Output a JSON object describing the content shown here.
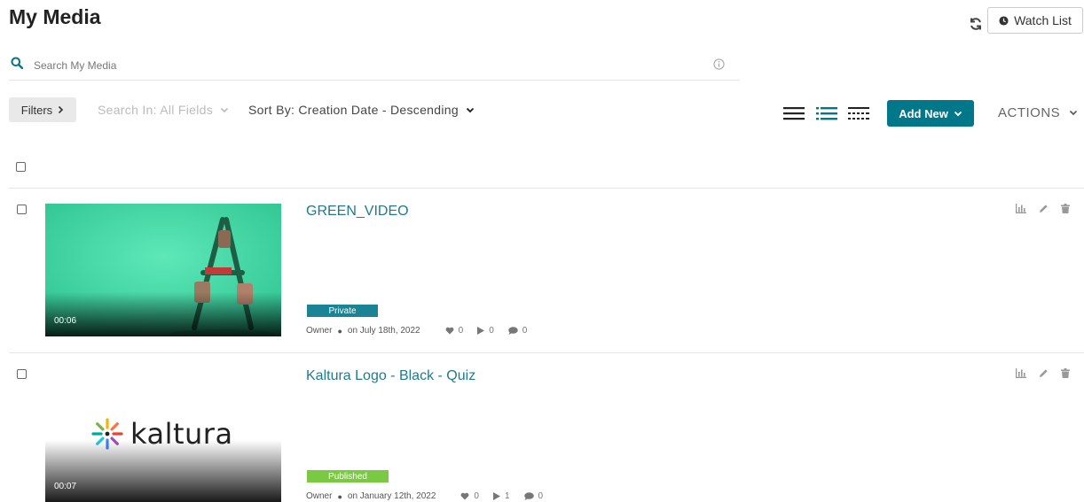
{
  "page": {
    "title": "My Media"
  },
  "header": {
    "watch_list_label": "Watch List",
    "refresh_icon": "refresh-icon",
    "clock_icon": "clock-icon"
  },
  "search": {
    "placeholder": "Search My Media",
    "icon": "search-icon",
    "info_icon": "info-icon"
  },
  "toolbar": {
    "filters_label": "Filters",
    "search_in_label": "Search In: All Fields",
    "sort_by_label": "Sort By: Creation Date - Descending",
    "views": [
      "view-list-icon",
      "view-detailed-icon",
      "view-compact-icon"
    ],
    "add_new_label": "Add New",
    "actions_label": "ACTIONS"
  },
  "colors": {
    "accent": "#00788a",
    "title_link": "#1f7a8c",
    "private_badge": "#1a8496",
    "published_badge": "#7ac943",
    "green_thumb": "#3fd9a7"
  },
  "media": [
    {
      "title": "GREEN_VIDEO",
      "duration": "00:06",
      "status": "Private",
      "owner": "Owner",
      "date": "on July 18th, 2022",
      "likes": "0",
      "plays": "0",
      "comments": "0"
    },
    {
      "title": "Kaltura Logo - Black - Quiz",
      "duration": "00:07",
      "status": "Published",
      "owner": "Owner",
      "date": "on January 12th, 2022",
      "likes": "0",
      "plays": "1",
      "comments": "0",
      "thumb_logo_text": "kaltura"
    }
  ]
}
